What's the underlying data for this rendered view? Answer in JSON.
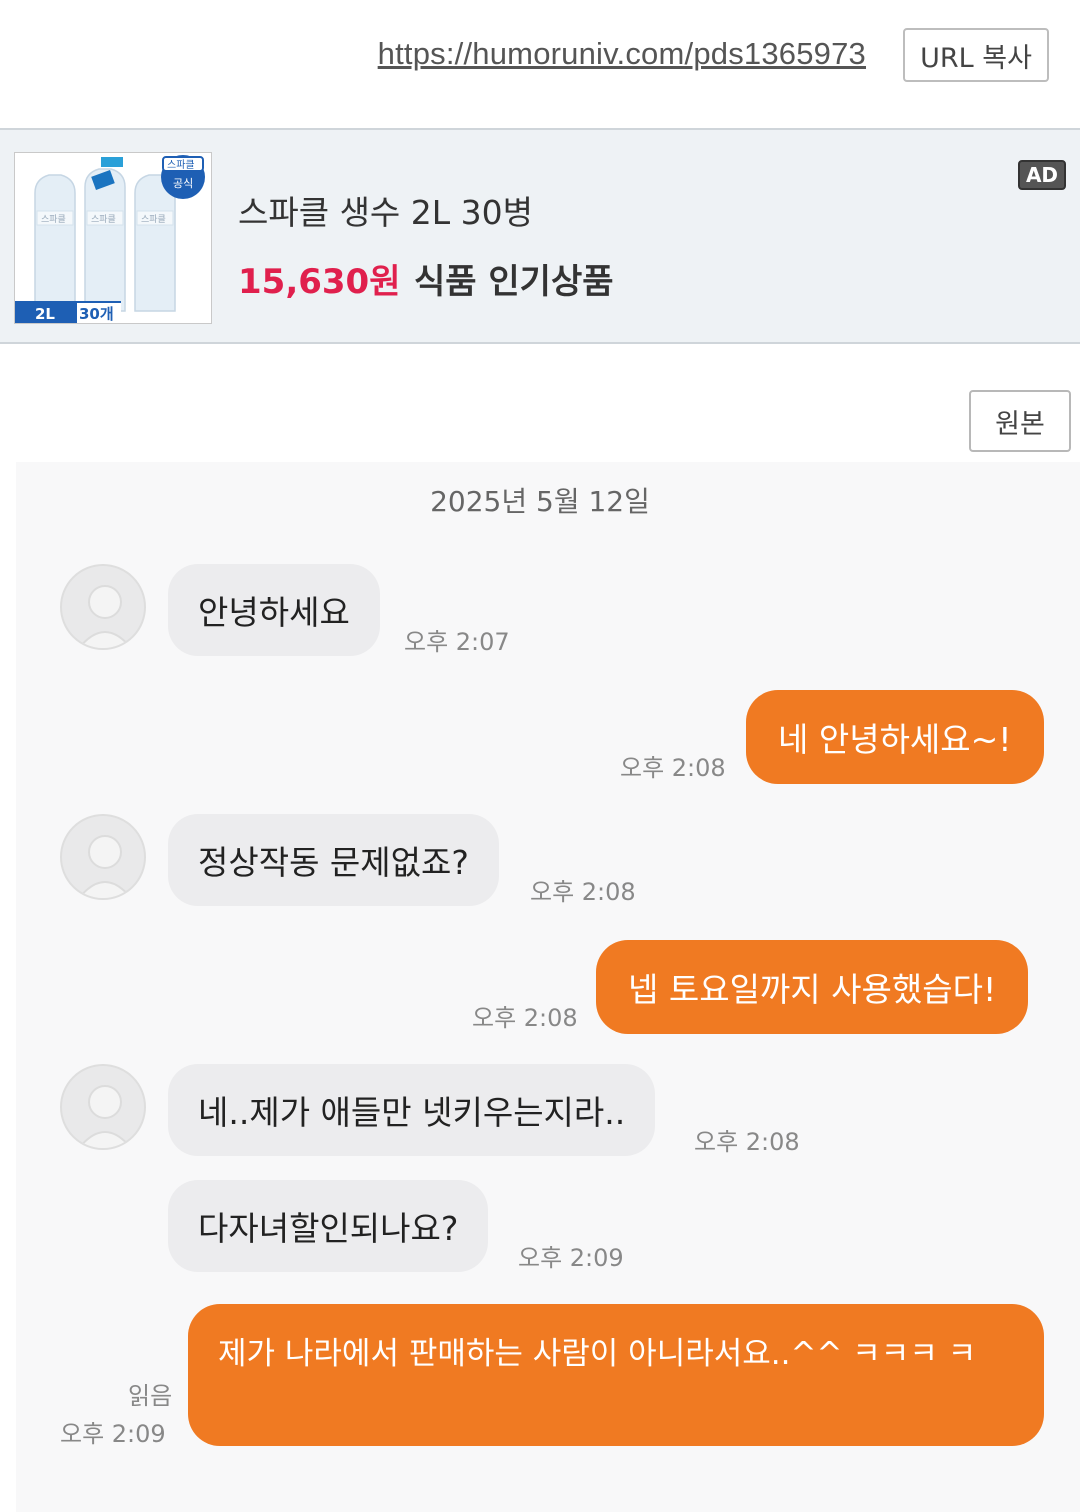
{
  "url_bar": {
    "url": "https://humoruniv.com/pds1365973",
    "copy_label": "URL 복사"
  },
  "ad": {
    "title": "스파클 생수 2L 30병",
    "price": "15,630원",
    "category": "식품 인기상품",
    "badge": "AD",
    "thumb_brand": "스파클",
    "thumb_badge_top": "스파클",
    "thumb_badge_bottom": "공식",
    "thumb_size": "2L",
    "thumb_count": "30개"
  },
  "original_button": "원본",
  "chat": {
    "date": "2025년 5월 12일",
    "messages": [
      {
        "side": "in",
        "text": "안녕하세요",
        "time": "오후 2:07"
      },
      {
        "side": "out",
        "text": "네 안녕하세요~!",
        "time": "오후 2:08"
      },
      {
        "side": "in",
        "text": "정상작동 문제없죠?",
        "time": "오후 2:08"
      },
      {
        "side": "out",
        "text": "넵 토요일까지 사용했습다!",
        "time": "오후 2:08"
      },
      {
        "side": "in",
        "text": "네..제가 애들만 넷키우는지라..",
        "time": "오후 2:08"
      },
      {
        "side": "in",
        "text": "다자녀할인되나요?",
        "time": "오후 2:09"
      },
      {
        "side": "out",
        "text": "제가 나라에서 판매하는 사람이 아니라서요..^^ ㅋㅋㅋ ㅋ",
        "time": "오후 2:09",
        "read": "읽음"
      }
    ]
  },
  "colors": {
    "accent_orange": "#f07a22",
    "price_red": "#e0204d",
    "incoming_bubble": "#ececee"
  }
}
